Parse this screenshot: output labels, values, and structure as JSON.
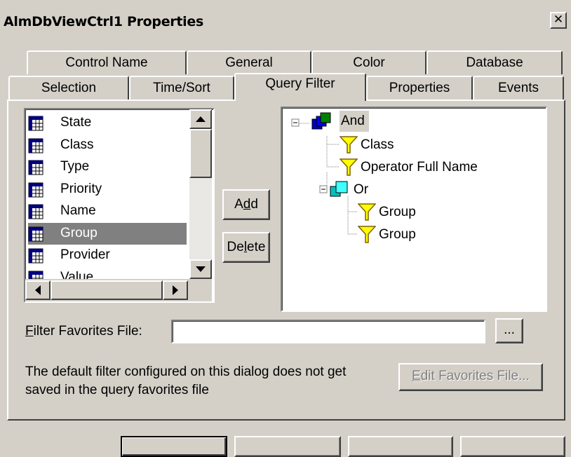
{
  "window": {
    "title": "AlmDbViewCtrl1 Properties",
    "close_label": "✕"
  },
  "tabs_back": [
    {
      "label": "Control Name"
    },
    {
      "label": "General"
    },
    {
      "label": "Color"
    },
    {
      "label": "Database"
    }
  ],
  "tabs_front": [
    {
      "label": "Selection"
    },
    {
      "label": "Time/Sort"
    },
    {
      "label": "Query Filter",
      "active": true
    },
    {
      "label": "Properties"
    },
    {
      "label": "Events"
    }
  ],
  "field_list": {
    "items": [
      {
        "label": "State"
      },
      {
        "label": "Class"
      },
      {
        "label": "Type"
      },
      {
        "label": "Priority"
      },
      {
        "label": "Name"
      },
      {
        "label": "Group",
        "selected": true
      },
      {
        "label": "Provider"
      },
      {
        "label": "Value"
      }
    ],
    "icon": "table-field-icon"
  },
  "buttons": {
    "add_pre": "A",
    "add_u": "d",
    "add_post": "d",
    "delete_pre": "De",
    "delete_u": "l",
    "delete_post": "ete",
    "browse": "..."
  },
  "filter_tree": {
    "root": {
      "label": "And",
      "icon": "logic-and-icon"
    },
    "nodes": [
      {
        "label": "Class",
        "icon": "filter-funnel-icon"
      },
      {
        "label": "Operator Full Name",
        "icon": "filter-funnel-icon"
      },
      {
        "label": "Or",
        "icon": "logic-or-icon"
      },
      {
        "label": "Group",
        "icon": "filter-funnel-icon"
      },
      {
        "label": "Group",
        "icon": "filter-funnel-icon"
      }
    ]
  },
  "favorites": {
    "label_u": "F",
    "label_rest": "ilter Favorites File:",
    "value": "",
    "note_line1": "The default filter configured on this dialog does not get",
    "note_line2": "saved in the query favorites file",
    "edit_u": "E",
    "edit_rest": "dit Favorites File..."
  },
  "colors": {
    "face": "#d4d0c8",
    "selection": "#808080",
    "disabled_text": "#808080",
    "and_icon": "#0000c0",
    "or_icon": "#00c0c0",
    "funnel": "#ffff00"
  }
}
